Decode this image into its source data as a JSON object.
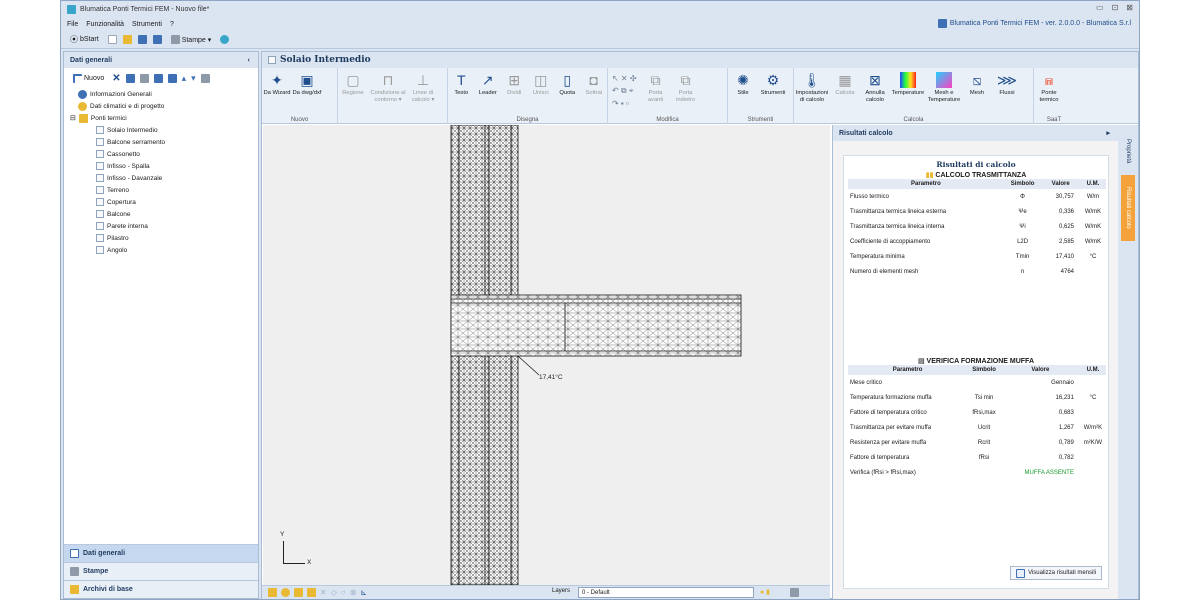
{
  "window": {
    "title": "Blumatica Ponti Termici FEM - Nuovo file*",
    "version_text": "Blumatica Ponti Termici FEM - ver. 2.0.0.0 - Blumatica S.r.l",
    "btn_min": "▭",
    "btn_max": "⊡",
    "btn_close": "⊠"
  },
  "menu": {
    "items": [
      "File",
      "Funzionalità",
      "Strumenti",
      "?"
    ]
  },
  "qat": {
    "bstart": "bStart",
    "stampe": "Stampe ▾"
  },
  "left": {
    "title": "Dati generali",
    "collapse": "‹",
    "nuovo": "Nuovo",
    "tree": {
      "info": "Informazioni Generali",
      "clima": "Dati climatici e di progetto",
      "ponti": "Ponti termici",
      "items": [
        "Solaio Intermedio",
        "Balcone serramento",
        "Cassonetto",
        "Infisso - Spalla",
        "Infisso - Davanzale",
        "Terreno",
        "Copertura",
        "Balcone",
        "Parete interna",
        "Pilastro",
        "Angolo"
      ]
    },
    "nav": [
      "Dati generali",
      "Stampe",
      "Archivi di base"
    ]
  },
  "doc": {
    "title": "Solaio Intermedio"
  },
  "ribbon": {
    "nuovo": [
      "Da Wizard",
      "Da dwg/dxf"
    ],
    "nuovo_label": "Nuovo",
    "region": [
      "Regione",
      "Condizione al contorno ▾",
      "Linee di calcolo ▾"
    ],
    "disegna": [
      "Testo",
      "Leader",
      "Dividi",
      "Unisci",
      "Quota",
      "Sottrai"
    ],
    "disegna_label": "Disegna",
    "modifica": [
      "Porta avanti",
      "Porta indietro"
    ],
    "modifica_label": "Modifica",
    "strumenti": [
      "Stile",
      "Strumenti"
    ],
    "strumenti_label": "Strumenti",
    "calcola": [
      "Impostazioni di calcolo",
      "Calcola",
      "Annulla calcolo",
      "Temperature",
      "Mesh e Temperature",
      "Mesh",
      "Flussi"
    ],
    "calcola_label": "Calcola",
    "saat": [
      "Ponte termico"
    ],
    "saat_label": "SaaT"
  },
  "canvas": {
    "temp_label": "17,41°C",
    "axis_x": "X",
    "axis_y": "Y"
  },
  "status": {
    "layers_label": "Layers",
    "layer_value": "0 - Default"
  },
  "results": {
    "panel_title": "Risultati calcolo",
    "card_title": "Risultati di calcolo",
    "trasm_title": "CALCOLO TRASMITTANZA",
    "headers": [
      "Parametro",
      "Simbolo",
      "Valore",
      "U.M."
    ],
    "trasm_rows": [
      [
        "Flusso termico",
        "Φ",
        "30,757",
        "W/m"
      ],
      [
        "Trasmittanza termica lineica esterna",
        "Ψe",
        "0,336",
        "W/mK"
      ],
      [
        "Trasmittanza termica lineica interna",
        "Ψi",
        "0,625",
        "W/mK"
      ],
      [
        "Coefficiente di accoppiamento",
        "L2D",
        "2,585",
        "W/mK"
      ],
      [
        "Temperatura minima",
        "Tmin",
        "17,410",
        "°C"
      ],
      [
        "Numero di elementi mesh",
        "n",
        "4764",
        ""
      ]
    ],
    "muffa_title": "VERIFICA FORMAZIONE MUFFA",
    "muffa_rows": [
      [
        "Mese critico",
        "",
        "Gennaio",
        ""
      ],
      [
        "Temperatura formazione muffa",
        "Tsi min",
        "16,231",
        "°C"
      ],
      [
        "Fattore di temperatura critico",
        "fRsi,max",
        "0,683",
        ""
      ],
      [
        "Trasmittanza per evitare muffa",
        "Ucrit",
        "1,267",
        "W/m²K"
      ],
      [
        "Resistenza per evitare muffa",
        "Rcrit",
        "0,789",
        "m²K/W"
      ],
      [
        "Fattore di temperatura",
        "fRsi",
        "0,782",
        ""
      ]
    ],
    "verify_label": "Verifica (fRsi > fRsi,max)",
    "verify_value": "MUFFA ASSENTE",
    "monthly_button": "Visualizza risultati mensili",
    "tab_proprieta": "Proprietà",
    "tab_risultati": "Risultati calcolo",
    "expand": "▸"
  }
}
